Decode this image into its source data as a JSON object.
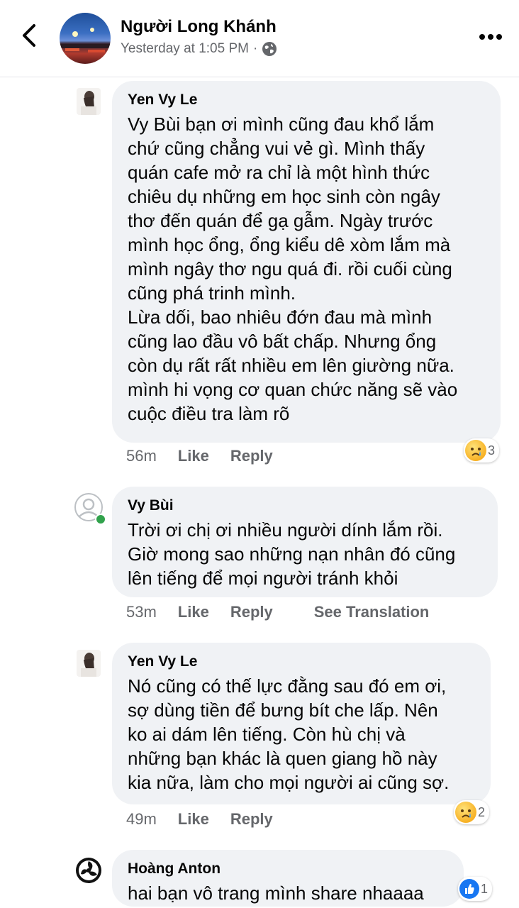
{
  "header": {
    "page_name": "Người Long Khánh",
    "timestamp": "Yesterday at 1:05 PM",
    "separator": "·",
    "icons": [
      "back-arrow-icon",
      "globe-icon",
      "more-dots-icon"
    ]
  },
  "comments": [
    {
      "author": "Yen Vy Le",
      "lines": [
        "Vy Bùi bạn ơi mình cũng đau khổ lắm",
        "chứ cũng chẳng vui vẻ gì. Mình thấy",
        "quán cafe mở ra chỉ là một hình thức",
        "chiêu dụ những em học sinh còn ngây",
        "thơ đến quán để gạ gẫm. Ngày trước",
        "mình học ổng, ổng kiểu dê xòm lắm mà",
        "mình ngây thơ ngu quá đi. rồi cuối cùng",
        "cũng phá trinh mình.",
        "Lừa dối, bao nhiêu đớn đau mà mình",
        "cũng lao đầu vô bất chấp. Nhưng ổng",
        "còn dụ rất rất nhiều em lên giường nữa.",
        "mình hi vọng cơ quan chức năng sẽ vào",
        "cuộc điều tra làm rõ"
      ],
      "time": "56m",
      "like": "Like",
      "reply": "Reply",
      "reaction_icon": "sad-face-icon",
      "reaction_count": "3"
    },
    {
      "author": "Vy Bùi",
      "lines": [
        "Trời ơi chị ơi nhiều người dính lắm rồi.",
        "Giờ mong sao những nạn nhân đó cũng",
        "lên tiếng để mọi người tránh khỏi"
      ],
      "time": "53m",
      "like": "Like",
      "reply": "Reply",
      "see_translation": "See Translation"
    },
    {
      "author": "Yen Vy Le",
      "lines": [
        "Nó cũng có thế lực đằng sau đó em ơi,",
        "sợ dùng tiền để bưng bít che lấp. Nên",
        "ko ai dám lên tiếng. Còn hù chị và",
        "những bạn khác là quen giang hồ này",
        "kia nữa, làm cho mọi người ai cũng sợ."
      ],
      "time": "49m",
      "like": "Like",
      "reply": "Reply",
      "reaction_icon": "sad-face-icon",
      "reaction_count": "2"
    },
    {
      "author": "Hoàng Anton",
      "lines": [
        "hai bạn vô trang mình share nhaaaa"
      ],
      "reaction_icon": "like-thumb-icon",
      "reaction_count": "1"
    }
  ],
  "colors": {
    "bubble": "#f0f2f5",
    "secondary_text": "#65676b",
    "online": "#31a24c",
    "like_blue": "#1877f2"
  }
}
